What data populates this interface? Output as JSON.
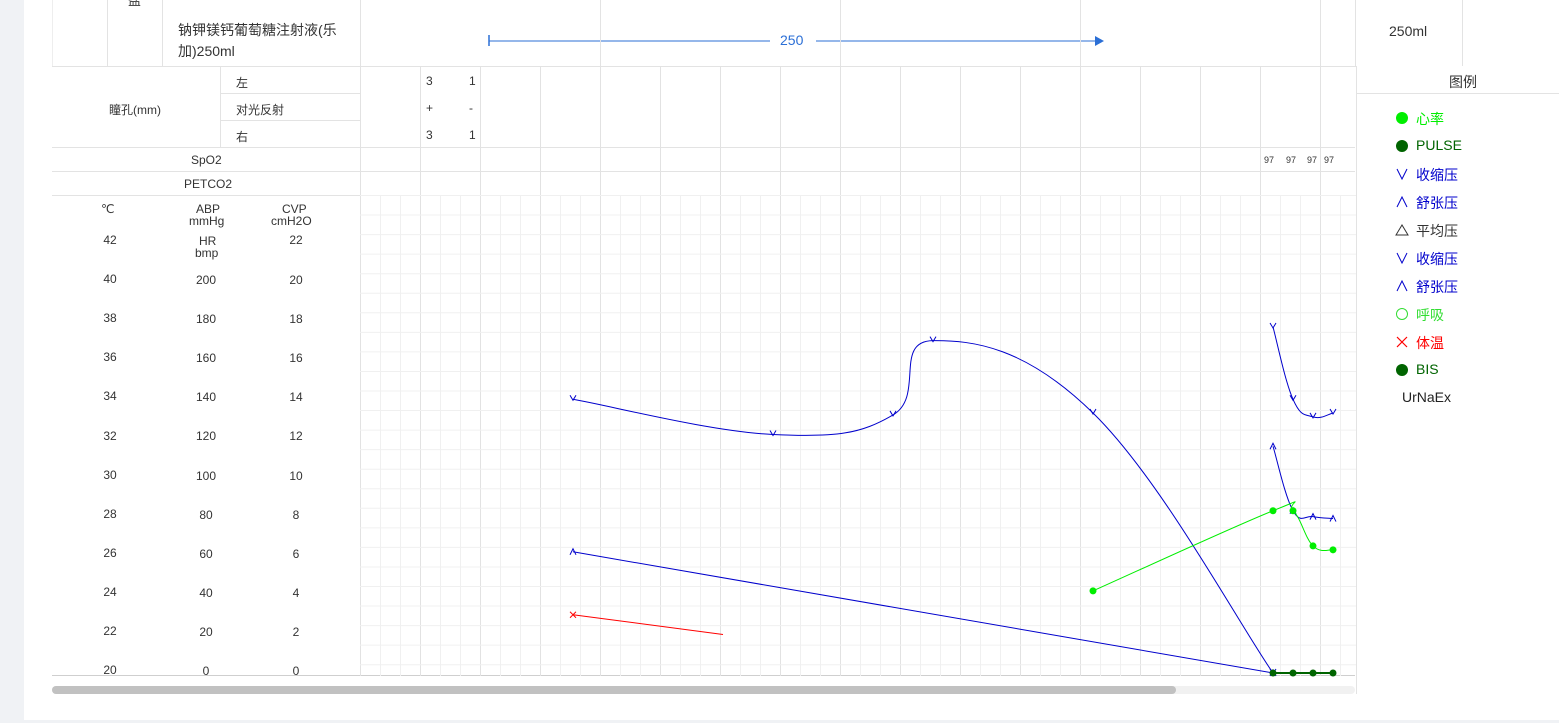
{
  "fluid": {
    "group_label": "盐",
    "drug_name": "钠钾镁钙葡萄糖注射液(乐加)250ml",
    "infusion_value": "250",
    "total": "250ml"
  },
  "pupil": {
    "title": "瞳孔(mm)",
    "rows": [
      {
        "label": "左",
        "v1": "3",
        "v2": "1"
      },
      {
        "label": "对光反射",
        "v1": "+",
        "v2": "-"
      },
      {
        "label": "右",
        "v1": "3",
        "v2": "1"
      }
    ]
  },
  "spo2": {
    "label": "SpO2",
    "values": [
      "97",
      "97",
      "97",
      "97"
    ]
  },
  "petco2": {
    "label": "PETCO2"
  },
  "axis": {
    "temp_unit": "℃",
    "abp_label": "ABP",
    "abp_unit": "mmHg",
    "hr_label": "HR",
    "hr_unit": "bmp",
    "cvp_label": "CVP",
    "cvp_unit": "cmH2O",
    "temp_ticks": [
      "42",
      "40",
      "38",
      "36",
      "34",
      "32",
      "30",
      "28",
      "26",
      "24",
      "22",
      "20"
    ],
    "abp_ticks": [
      "200",
      "180",
      "160",
      "140",
      "120",
      "100",
      "80",
      "60",
      "40",
      "20",
      "0"
    ],
    "cvp_ticks": [
      "22",
      "20",
      "18",
      "16",
      "14",
      "12",
      "10",
      "8",
      "6",
      "4",
      "2",
      "0"
    ]
  },
  "legend": {
    "title": "图例",
    "items": [
      {
        "label": "心率",
        "symbol": "filled-circle",
        "color": "#00ee00"
      },
      {
        "label": "PULSE",
        "symbol": "filled-circle",
        "color": "#006400"
      },
      {
        "label": "收缩压",
        "symbol": "v",
        "color": "#0000cc"
      },
      {
        "label": "舒张压",
        "symbol": "caret",
        "color": "#0000cc"
      },
      {
        "label": "平均压",
        "symbol": "triangle",
        "color": "#333333"
      },
      {
        "label": "收缩压",
        "symbol": "v",
        "color": "#0000cc"
      },
      {
        "label": "舒张压",
        "symbol": "caret",
        "color": "#0000cc"
      },
      {
        "label": "呼吸",
        "symbol": "circle",
        "color": "#33dd33"
      },
      {
        "label": "体温",
        "symbol": "x",
        "color": "#ff0000"
      },
      {
        "label": "BIS",
        "symbol": "filled-circle",
        "color": "#006400"
      },
      {
        "label": "UrNaEx",
        "symbol": "none",
        "color": "#000000"
      }
    ]
  },
  "chart_data": {
    "type": "line",
    "abp_range": [
      0,
      200
    ],
    "series": [
      {
        "name": "收缩压",
        "color": "#0000cc",
        "marker": "v",
        "segments": [
          [
            [
              0,
              140
            ],
            [
              1,
              122
            ],
            [
              1.6,
              132
            ],
            [
              1.8,
              170
            ],
            [
              2.6,
              133
            ],
            [
              3.5,
              0
            ]
          ],
          [
            [
              3.5,
              177
            ],
            [
              3.6,
              140
            ],
            [
              3.7,
              131
            ],
            [
              3.8,
              133
            ]
          ]
        ]
      },
      {
        "name": "舒张压",
        "color": "#0000cc",
        "marker": "caret",
        "segments": [
          [
            [
              0,
              62
            ],
            [
              3.5,
              0
            ]
          ],
          [
            [
              3.5,
              116
            ],
            [
              3.6,
              83
            ],
            [
              3.7,
              80
            ],
            [
              3.8,
              79
            ]
          ]
        ]
      },
      {
        "name": "心率",
        "color": "#00ee00",
        "marker": "filled-circle",
        "segments": [
          [
            [
              2.6,
              42
            ],
            [
              3.5,
              83
            ],
            [
              3.6,
              83
            ],
            [
              3.7,
              65
            ],
            [
              3.8,
              63
            ]
          ]
        ]
      },
      {
        "name": "PULSE",
        "color": "#006400",
        "marker": "filled-circle",
        "segments": [
          [
            [
              3.5,
              0
            ],
            [
              3.6,
              0
            ],
            [
              3.7,
              0
            ],
            [
              3.8,
              0
            ]
          ]
        ]
      },
      {
        "name": "体温",
        "color": "#ff0000",
        "marker": "x",
        "segments": [
          [
            [
              0,
              29.8
            ],
            [
              0.75,
              19.7
            ]
          ]
        ]
      }
    ]
  },
  "scroll": {
    "thumb_fraction": 0.863
  }
}
